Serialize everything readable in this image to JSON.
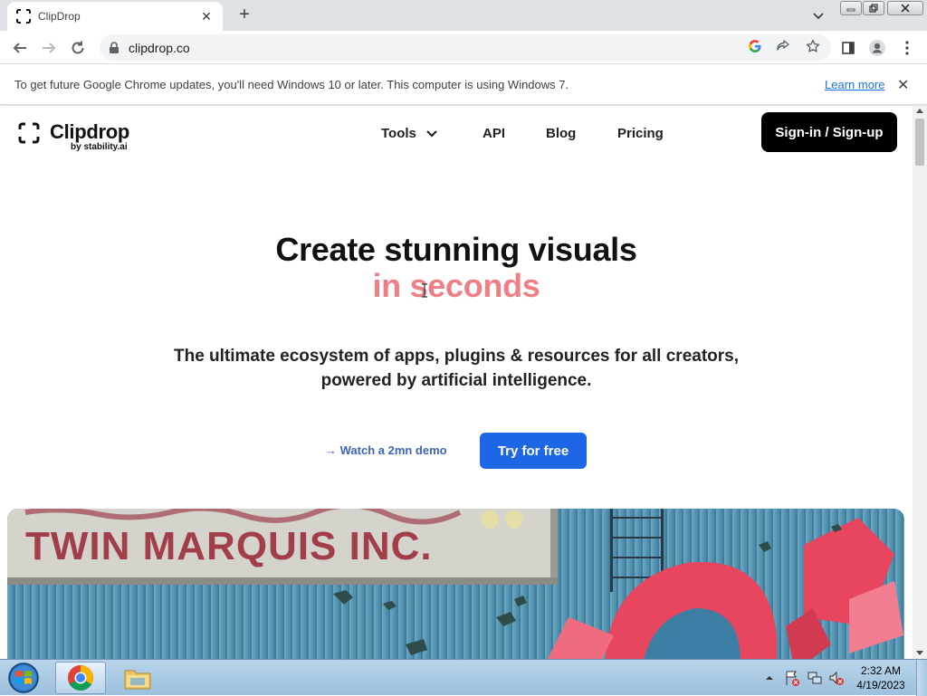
{
  "browser": {
    "tab_title": "ClipDrop",
    "url": "clipdrop.co",
    "infobar_message": "To get future Google Chrome updates, you'll need Windows 10 or later. This computer is using Windows 7.",
    "infobar_link": "Learn more"
  },
  "site": {
    "logo_name": "Clipdrop",
    "logo_sub": "by stability.ai",
    "nav": {
      "tools": "Tools",
      "api": "API",
      "blog": "Blog",
      "pricing": "Pricing"
    },
    "signin_label": "Sign-in / Sign-up",
    "hero": {
      "title_line1": "Create stunning visuals",
      "title_line2": "in seconds",
      "subtitle_line1": "The ultimate ecosystem of apps, plugins & resources for all creators,",
      "subtitle_line2": "powered by artificial intelligence.",
      "demo_link": "→ Watch a 2mn demo",
      "try_button": "Try for free",
      "image_sign_text": "TWIN MARQUIS INC."
    }
  },
  "taskbar": {
    "time": "2:32 AM",
    "date": "4/19/2023"
  },
  "colors": {
    "accent_pink": "#ef7f86",
    "try_blue": "#1d67e7",
    "link_blue": "#3f63b9"
  }
}
